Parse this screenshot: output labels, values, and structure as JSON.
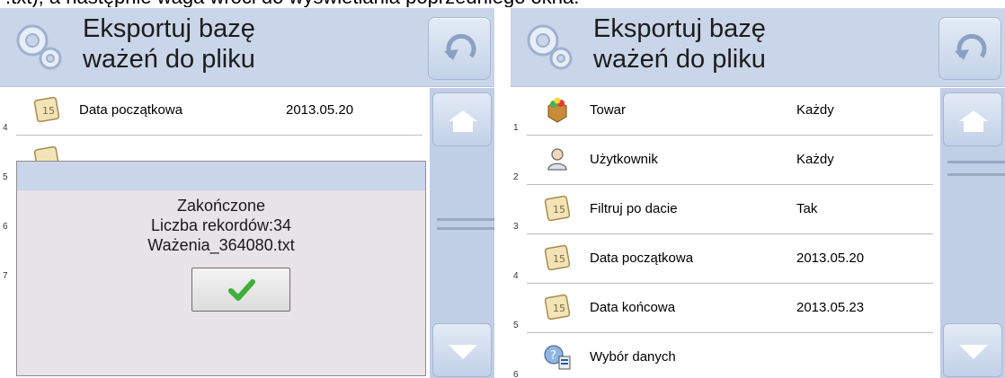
{
  "caption_text": ".txt), a następnie waga wróci do wyświetlania poprzedniego okna.",
  "left_screen": {
    "title_line1": "Eksportuj bazę",
    "title_line2": "ważeń do pliku",
    "visible_rows": [
      {
        "number": "4",
        "label": "Data początkowa",
        "value": "2013.05.20",
        "icon": "calendar-icon"
      },
      {
        "number": "5",
        "label": "",
        "value": "",
        "icon": "calendar-icon"
      },
      {
        "number": "6",
        "label": "",
        "value": "",
        "icon": ""
      },
      {
        "number": "7",
        "label": "",
        "value": "",
        "icon": ""
      }
    ],
    "dialog": {
      "line1": "Zakończone",
      "line2": "Liczba rekordów:34",
      "line3": "Ważenia_364080.txt",
      "ok_icon": "checkmark-icon"
    }
  },
  "right_screen": {
    "title_line1": "Eksportuj bazę",
    "title_line2": "ważeń do pliku",
    "rows": [
      {
        "number": "1",
        "label": "Towar",
        "value": "Każdy",
        "icon": "product-box-icon"
      },
      {
        "number": "2",
        "label": "Użytkownik",
        "value": "Każdy",
        "icon": "user-icon"
      },
      {
        "number": "3",
        "label": "Filtruj po dacie",
        "value": "Tak",
        "icon": "calendar-icon"
      },
      {
        "number": "4",
        "label": "Data początkowa",
        "value": "2013.05.20",
        "icon": "calendar-icon"
      },
      {
        "number": "5",
        "label": "Data końcowa",
        "value": "2013.05.23",
        "icon": "calendar-icon"
      },
      {
        "number": "6",
        "label": "Wybór danych",
        "value": "",
        "icon": "data-selection-icon"
      }
    ]
  },
  "colors": {
    "header_bg": "#c9d5e8",
    "side_bg": "#c0cfe6",
    "dialog_bg": "#e7e3e6",
    "checkmark": "#3fae3a"
  }
}
